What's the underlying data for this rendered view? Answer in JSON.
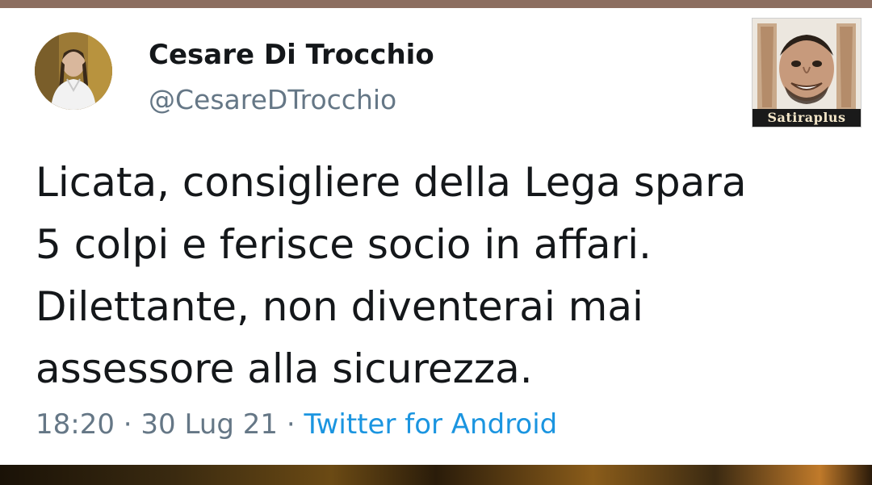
{
  "tweet": {
    "author_name": "Cesare Di Trocchio",
    "author_handle": "@CesareDTrocchio",
    "text_lines": [
      "Licata, consigliere della Lega spara",
      "5 colpi e ferisce socio in affari.",
      "Dilettante, non diventerai mai",
      "assessore alla sicurezza."
    ],
    "time": "18:20",
    "separator": " · ",
    "date": "30 Lug 21",
    "source": "Twitter for Android"
  },
  "sticker": {
    "label": "Satiraplus"
  },
  "colors": {
    "text": "#14171a",
    "muted": "#657786",
    "link": "#1b95e0",
    "top_band": "#8c6e60"
  }
}
